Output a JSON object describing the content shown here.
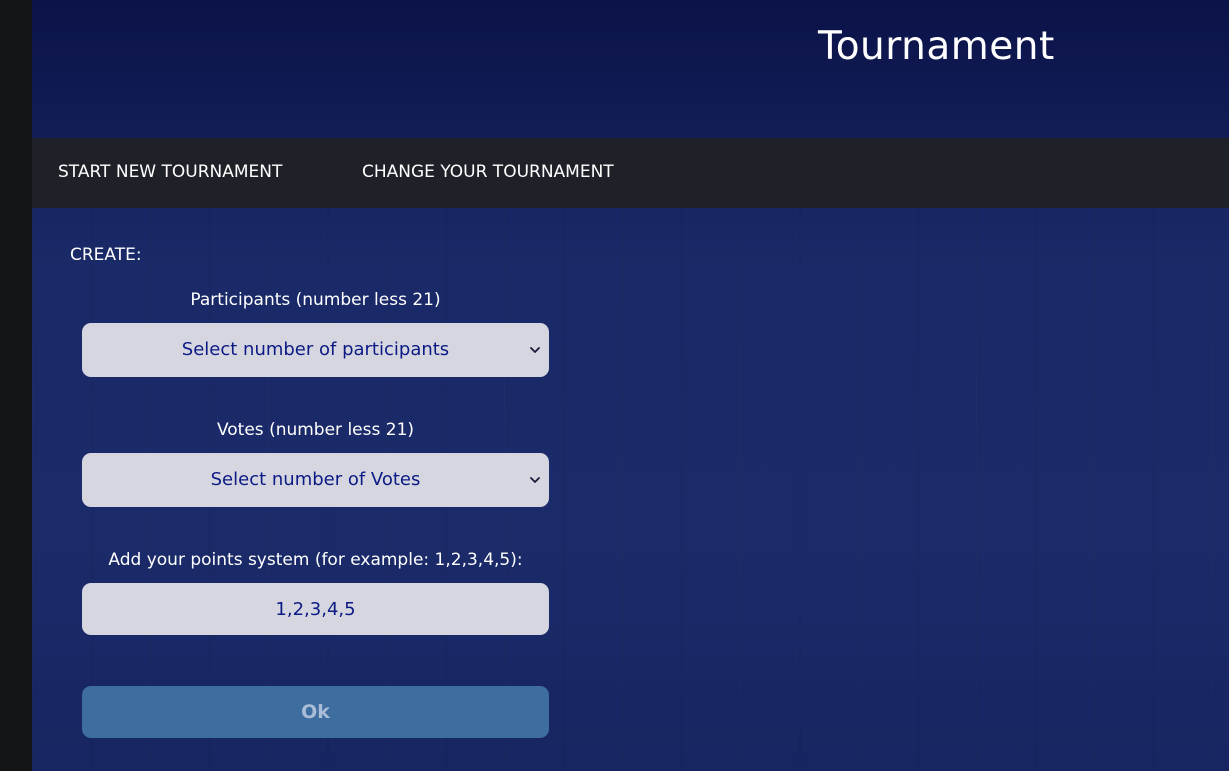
{
  "header": {
    "title": "Tournament"
  },
  "nav": {
    "start_new": "START NEW TOURNAMENT",
    "change": "CHANGE YOUR TOURNAMENT"
  },
  "form": {
    "section_label": "CREATE:",
    "participants": {
      "label": "Participants (number less 21)",
      "selected": "Select number of participants"
    },
    "votes": {
      "label": "Votes (number less 21)",
      "selected": "Select number of Votes"
    },
    "points": {
      "label": "Add your points system (for example: 1,2,3,4,5):",
      "value": "1,2,3,4,5"
    },
    "submit_label": "Ok"
  },
  "icons": {
    "select_arrow": "chevron-down-icon"
  },
  "colors": {
    "background": "#17245f",
    "navbar": "#1f2128",
    "field_bg": "#d6d6e0",
    "field_text": "#0b1a84",
    "button_bg": "#3e6d9f",
    "button_text": "#a9bdd6"
  }
}
